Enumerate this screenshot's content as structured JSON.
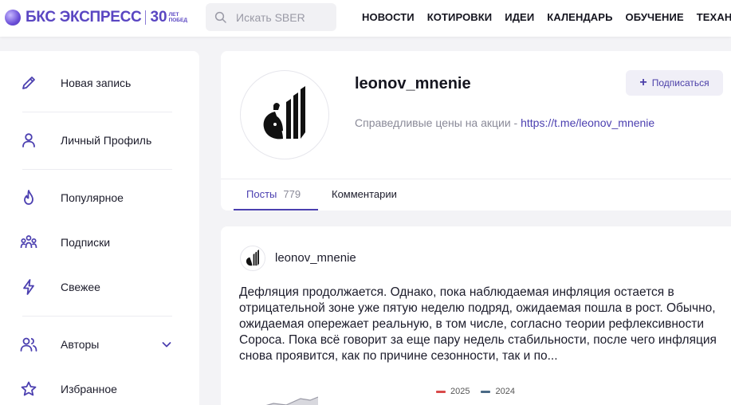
{
  "header": {
    "logo_text": "БКС ЭКСПРЕСС",
    "logo_number": "30",
    "logo_small_1": "ЛЕТ",
    "logo_small_2": "ПОБЕД",
    "search_placeholder": "Искать SBER",
    "nav": [
      "НОВОСТИ",
      "КОТИРОВКИ",
      "ИДЕИ",
      "КАЛЕНДАРЬ",
      "ОБУЧЕНИЕ",
      "ТЕХАНАЛИЗ"
    ]
  },
  "sidebar": {
    "items": [
      {
        "label": "Новая запись",
        "icon": "pencil-icon"
      },
      {
        "label": "Личный Профиль",
        "icon": "user-icon"
      },
      {
        "label": "Популярное",
        "icon": "fire-icon"
      },
      {
        "label": "Подписки",
        "icon": "users-group-icon"
      },
      {
        "label": "Свежее",
        "icon": "lightning-icon"
      },
      {
        "label": "Авторы",
        "icon": "authors-icon"
      },
      {
        "label": "Избранное",
        "icon": "star-icon"
      }
    ]
  },
  "profile": {
    "name": "leonov_mnenie",
    "description": "Справедливые цены на акции - ",
    "link": "https://t.me/leonov_mnenie",
    "subscribe_label": "Подписаться",
    "tabs": {
      "posts_label": "Посты",
      "posts_count": "779",
      "comments_label": "Комментарии"
    }
  },
  "post": {
    "author": "leonov_mnenie",
    "text": "Дефляция продолжается. Однако, пока наблюдаемая инфляция остается в отрицательной зоне уже пятую неделю подряд, ожидаемая пошла в рост. Обычно, ожидаемая опережает реальную, в том числе, согласно теории рефлексивности Сороса. Пока всё говорит за еще пару недель стабильности, после чего инфляция снова проявится, как по причине сезонности, так и по...",
    "legend": [
      {
        "label": "2025",
        "color": "#d94a4a"
      },
      {
        "label": "2024",
        "color": "#4a6a86"
      }
    ]
  },
  "colors": {
    "accent": "#4b3fb0",
    "brand": "#5a46c2"
  }
}
